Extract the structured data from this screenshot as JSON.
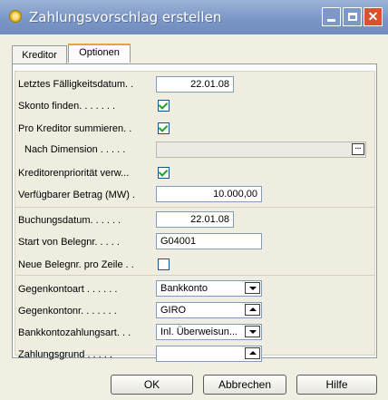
{
  "window": {
    "title": "Zahlungsvorschlag erstellen"
  },
  "tabs": [
    {
      "label": "Kreditor"
    },
    {
      "label": "Optionen"
    }
  ],
  "fields": {
    "letztes_faelligkeitsdatum": {
      "label": "Letztes Fälligkeitsdatum. .",
      "value": "22.01.08"
    },
    "skonto_finden": {
      "label": "Skonto finden. . . . . . .",
      "checked": true
    },
    "pro_kreditor_summieren": {
      "label": "Pro Kreditor summieren. .",
      "checked": true
    },
    "nach_dimension": {
      "label": "Nach Dimension . . . . .",
      "value": ""
    },
    "kreditorenprioritaet": {
      "label": "Kreditorenpriorität verw...",
      "checked": true
    },
    "verfuegbarer_betrag": {
      "label": "Verfügbarer Betrag (MW) .",
      "value": "10.000,00"
    },
    "buchungsdatum": {
      "label": "Buchungsdatum. . . . . .",
      "value": "22.01.08"
    },
    "start_belegnr": {
      "label": "Start von Belegnr. . . . .",
      "value": "G04001"
    },
    "neue_belegnr": {
      "label": "Neue Belegnr. pro Zeile . .",
      "checked": false
    },
    "gegenkontoart": {
      "label": "Gegenkontoart . . . . . .",
      "value": "Bankkonto"
    },
    "gegenkontonr": {
      "label": "Gegenkontonr. . . . . . .",
      "value": "GIRO"
    },
    "bankkontozahlungsart": {
      "label": "Bankkontozahlungsart. . .",
      "value": "Inl. Überweisun..."
    },
    "zahlungsgrund": {
      "label": "Zahlungsgrund . . . . .",
      "value": ""
    }
  },
  "buttons": {
    "ok": "OK",
    "cancel": "Abbrechen",
    "help": "Hilfe"
  }
}
